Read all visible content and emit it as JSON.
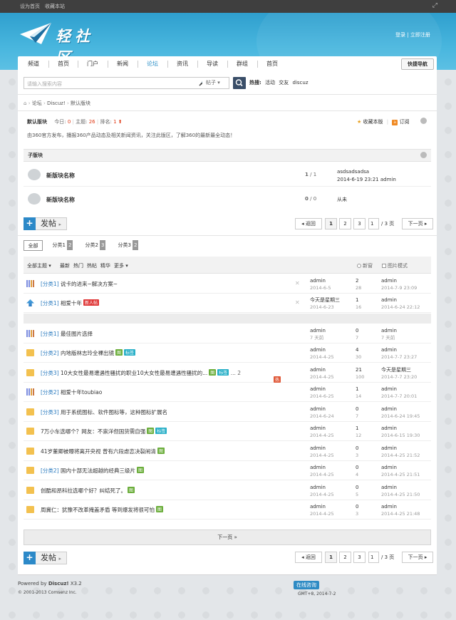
{
  "topbar": {
    "set_home": "设为首页",
    "bookmark": "收藏本站"
  },
  "header": {
    "logo_text": "轻社区",
    "login": "登录",
    "register": "立即注册",
    "sep": "|"
  },
  "nav": {
    "items": [
      "频道",
      "首页",
      "门户",
      "新闻",
      "论坛",
      "资讯",
      "导读",
      "群组",
      "首页"
    ],
    "active_index": 4,
    "quick": "快捷导航"
  },
  "search": {
    "placeholder": "请输入搜索内容",
    "type": "帖子",
    "hot_label": "热搜:",
    "hot": [
      "活动",
      "交友",
      "discuz"
    ]
  },
  "breadcrumb": [
    "论坛",
    "Discuz!",
    "默认版块"
  ],
  "forum": {
    "name": "默认版块",
    "today_label": "今日:",
    "today": "0",
    "topics_label": "主题:",
    "topics": "26",
    "rank_label": "排名:",
    "rank": "1",
    "fav": "收藏本版",
    "rss": "订阅",
    "desc": "由360官方发布，播报360产品动态及相关新闻资讯，关注此版区，了解360的最新最全动态！"
  },
  "subforums": {
    "title": "子版块",
    "rows": [
      {
        "name": "新版块名称",
        "count": "1",
        "total": "1",
        "lp_title": "asdsadsadsa",
        "lp_meta": "2014-6-19 23:21 admin"
      },
      {
        "name": "新版块名称",
        "count": "0",
        "total": "0",
        "lp_title": "从未",
        "lp_meta": ""
      }
    ]
  },
  "post_button": {
    "plus": "+",
    "label": "发帖"
  },
  "pager": {
    "prev": "返回",
    "pages": [
      "1",
      "2",
      "3"
    ],
    "input": "1",
    "total": "/ 3 页",
    "next": "下一页"
  },
  "tabs": [
    {
      "label": "全部",
      "count": ""
    },
    {
      "label": "分类1",
      "count": "2"
    },
    {
      "label": "分类2",
      "count": "3"
    },
    {
      "label": "分类3",
      "count": "2"
    }
  ],
  "thread_header": {
    "filter_all": "全部主题",
    "latest": "最新",
    "hot": "热门",
    "hotspot": "热帖",
    "digest": "精华",
    "more": "更多",
    "new_window": "新窗",
    "pic_mode": "图片模式"
  },
  "threads": [
    {
      "icon": "stat",
      "cat": "[分类1]",
      "title": "说卡的进来~解决方案~",
      "badges": [],
      "x": true,
      "author": "admin",
      "date": "2014-6-5",
      "replies": "2",
      "views": "28",
      "lp_user": "admin",
      "lp_date": "2014-7-9 23:09"
    },
    {
      "icon": "up",
      "cat": "[分类1]",
      "title": "相爱十年",
      "badges": [
        {
          "t": "新人帖",
          "c": "new"
        }
      ],
      "x": true,
      "author": "今天是星期三",
      "date": "2014-6-23",
      "replies": "1",
      "views": "16",
      "lp_user": "admin",
      "lp_date": "2014-6-24 22:12"
    },
    {
      "icon": "stat",
      "cat": "[分类1]",
      "title": "最佳图片选择",
      "badges": [],
      "x": false,
      "author": "admin",
      "date": "7 天前",
      "replies": "0",
      "views": "7",
      "lp_user": "admin",
      "lp_date": "7 天前"
    },
    {
      "icon": "fold",
      "cat": "[分类2]",
      "title": "内地版林志玲全裸出镜",
      "badges": [
        {
          "t": "图",
          "c": "img"
        },
        {
          "t": "标签",
          "c": "tag"
        }
      ],
      "x": false,
      "author": "admin",
      "date": "2014-4-25",
      "replies": "4",
      "views": "30",
      "lp_user": "admin",
      "lp_date": "2014-7-7 23:27"
    },
    {
      "icon": "fold",
      "cat": "[分类3]",
      "title": "10大女性最易遭遇性骚扰的职业10大女性最易遭遇性骚扰的...",
      "badges": [
        {
          "t": "热",
          "c": "hot"
        },
        {
          "t": "图",
          "c": "img"
        },
        {
          "t": "标签",
          "c": "tag"
        }
      ],
      "extra": "... 2",
      "x": false,
      "author": "admin",
      "date": "2014-4-25",
      "replies": "21",
      "views": "100",
      "lp_user": "今天是星期三",
      "lp_date": "2014-7-7 23:20"
    },
    {
      "icon": "stat",
      "cat": "[分类2]",
      "title": "相爱十年toubiao",
      "badges": [],
      "x": false,
      "author": "admin",
      "date": "2014-6-25",
      "replies": "1",
      "views": "14",
      "lp_user": "admin",
      "lp_date": "2014-7-7 20:01"
    },
    {
      "icon": "fold",
      "cat": "[分类3]",
      "title": "用于系统图标、软件图标等，这种图标扩展名",
      "badges": [],
      "x": false,
      "author": "admin",
      "date": "2014-6-24",
      "replies": "0",
      "views": "7",
      "lp_user": "admin",
      "lp_date": "2014-6-24 19:45"
    },
    {
      "icon": "fold",
      "cat": "",
      "title": "7万小车选哪个？网友：不崇洋但国货需自强",
      "badges": [
        {
          "t": "图",
          "c": "img"
        },
        {
          "t": "标签",
          "c": "tag"
        }
      ],
      "x": false,
      "author": "admin",
      "date": "2014-4-25",
      "replies": "1",
      "views": "12",
      "lp_user": "admin",
      "lp_date": "2014-6-15 19:30"
    },
    {
      "icon": "fold",
      "cat": "",
      "title": "41岁董卿被曝将离开央视 曾有六段虐恋决裂闹清",
      "badges": [
        {
          "t": "图",
          "c": "img"
        }
      ],
      "x": false,
      "author": "admin",
      "date": "2014-4-25",
      "replies": "0",
      "views": "3",
      "lp_user": "admin",
      "lp_date": "2014-4-25 21:52"
    },
    {
      "icon": "fold",
      "cat": "[分类2]",
      "title": "国内十部无法超越的经典三级片",
      "badges": [
        {
          "t": "图",
          "c": "img"
        }
      ],
      "x": false,
      "author": "admin",
      "date": "2014-4-25",
      "replies": "0",
      "views": "4",
      "lp_user": "admin",
      "lp_date": "2014-4-25 21:51"
    },
    {
      "icon": "fold",
      "cat": "",
      "title": "创酷和昂科拉选哪个好？纠结死了。",
      "badges": [
        {
          "t": "图",
          "c": "img"
        }
      ],
      "x": false,
      "author": "admin",
      "date": "2014-4-25",
      "replies": "0",
      "views": "5",
      "lp_user": "admin",
      "lp_date": "2014-4-25 21:50"
    },
    {
      "icon": "fold",
      "cat": "",
      "title": "周冀仁：犹豫不改革掩盖矛盾 等到爆发将很可怕",
      "badges": [
        {
          "t": "图",
          "c": "img"
        }
      ],
      "x": false,
      "author": "admin",
      "date": "2014-4-25",
      "replies": "0",
      "views": "3",
      "lp_user": "admin",
      "lp_date": "2014-4-25 21:48"
    }
  ],
  "next_bar": "下一页 »",
  "footer": {
    "powered": "Powered by",
    "brand": "Discuz!",
    "ver": "X3.2",
    "copy": "© 2001-2013 Comsenz Inc.",
    "online": "在线咨询",
    "time": "GMT+8, 2014-7-2"
  },
  "colors": {
    "accent": "#2b8fc7",
    "header_blue": "#48b6de",
    "red": "#e03a16"
  }
}
